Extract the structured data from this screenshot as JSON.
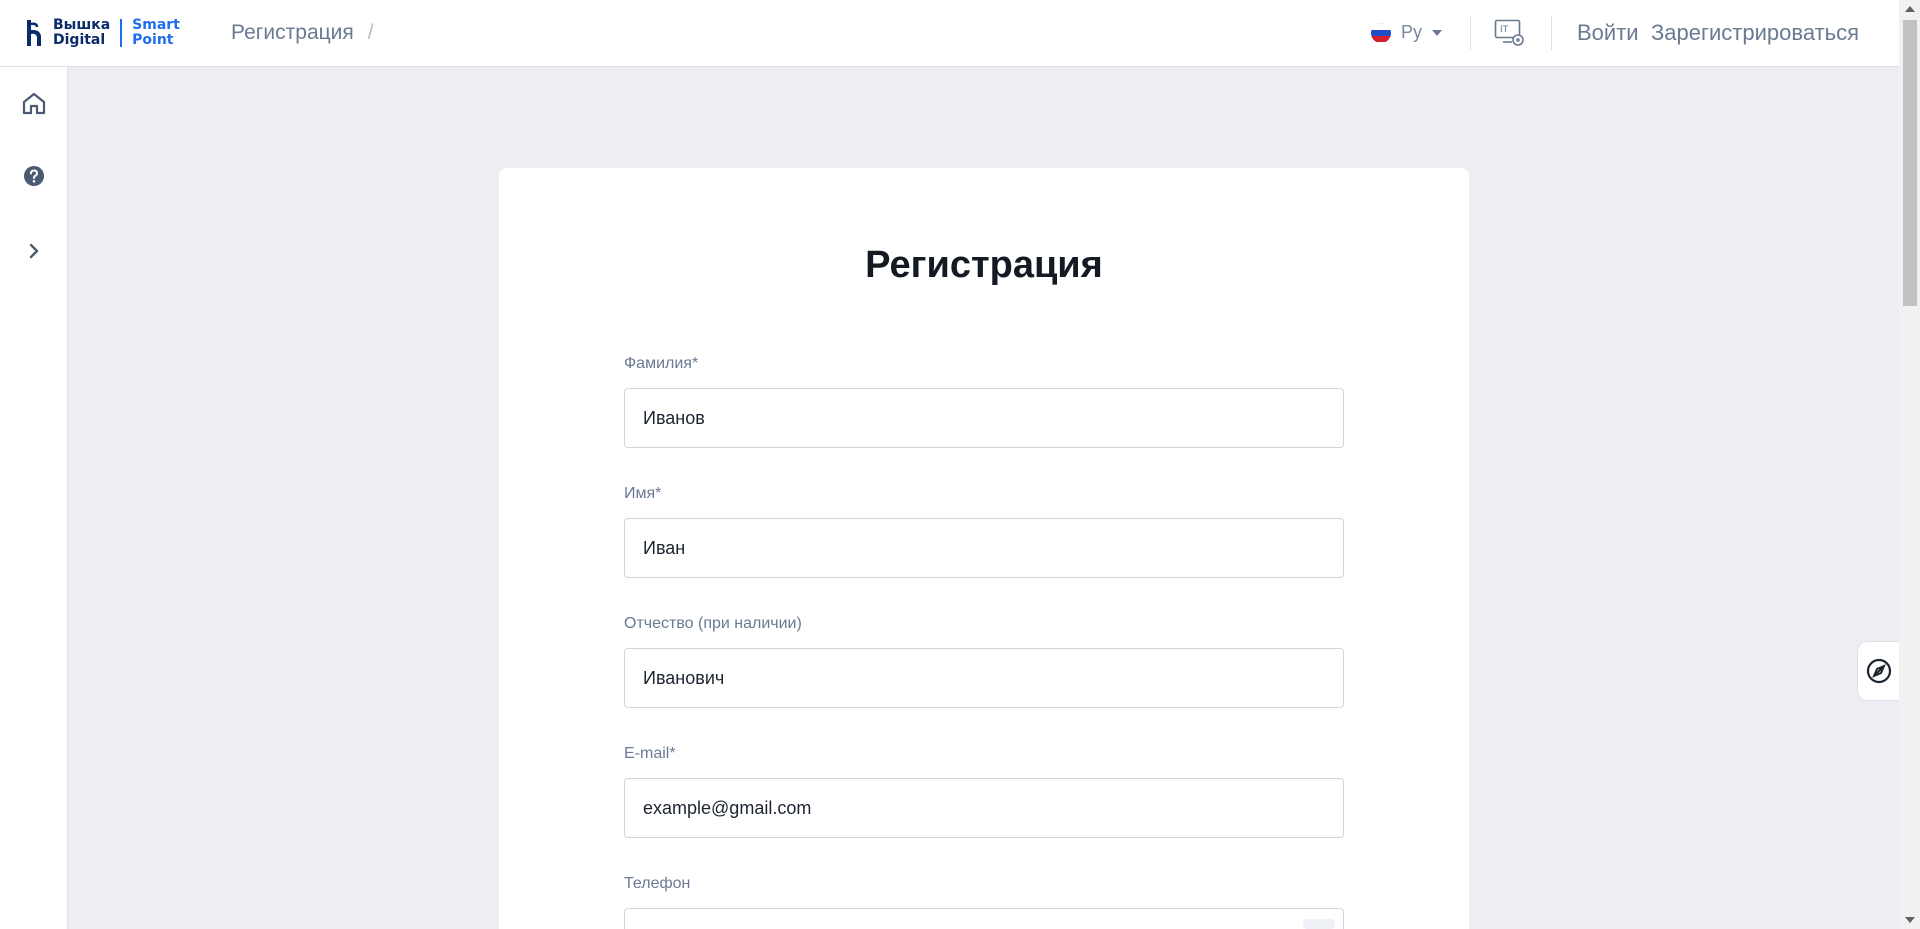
{
  "header": {
    "logo": {
      "line1": "Вышка",
      "line2": "Digital",
      "brand1": "Smart",
      "brand2": "Point"
    },
    "breadcrumb": {
      "current": "Регистрация",
      "separator": "/"
    },
    "language": {
      "label": "Ру",
      "flag_colors": [
        "#ffffff",
        "#1f4fc8",
        "#d5202b"
      ]
    },
    "it_icon": "it-settings-icon",
    "login_label": "Войти",
    "register_label": "Зарегистрироваться"
  },
  "sidebar": {
    "items": [
      {
        "icon": "home-icon"
      },
      {
        "icon": "help-icon"
      },
      {
        "icon": "chevron-right-icon"
      }
    ]
  },
  "form": {
    "title": "Регистрация",
    "fields": [
      {
        "label": "Фамилия*",
        "value": "Иванов"
      },
      {
        "label": "Имя*",
        "value": "Иван"
      },
      {
        "label": "Отчество (при наличии)",
        "value": "Иванович"
      },
      {
        "label": "E-mail*",
        "value": "example@gmail.com"
      },
      {
        "label": "Телефон",
        "value": ""
      }
    ]
  },
  "floating_button": {
    "icon": "compass-icon"
  },
  "colors": {
    "accent": "#1f6ef0",
    "brand_dark": "#0c2b6b",
    "background": "#eceef3",
    "muted_text": "#6a7a92"
  }
}
